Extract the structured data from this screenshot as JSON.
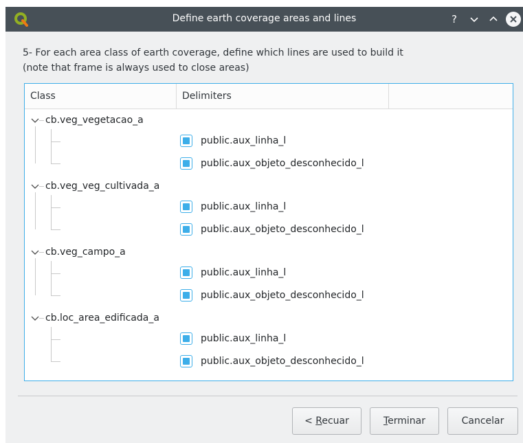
{
  "window": {
    "title": "Define earth coverage areas and lines",
    "help_glyph": "?",
    "minimize_glyph": "⌄",
    "maximize_glyph": "⌃"
  },
  "instructions": {
    "line1": "5- For each area class of earth coverage, define which lines are used to build it",
    "line2": "(note that frame is always used to close areas)"
  },
  "tree": {
    "headers": [
      "Class",
      "Delimiters",
      ""
    ],
    "groups": [
      {
        "label": "cb.veg_vegetacao_a",
        "expanded": true,
        "children": [
          {
            "label": "public.aux_linha_l",
            "checked": true
          },
          {
            "label": "public.aux_objeto_desconhecido_l",
            "checked": true
          }
        ]
      },
      {
        "label": "cb.veg_veg_cultivada_a",
        "expanded": true,
        "children": [
          {
            "label": "public.aux_linha_l",
            "checked": true
          },
          {
            "label": "public.aux_objeto_desconhecido_l",
            "checked": true
          }
        ]
      },
      {
        "label": "cb.veg_campo_a",
        "expanded": true,
        "children": [
          {
            "label": "public.aux_linha_l",
            "checked": true
          },
          {
            "label": "public.aux_objeto_desconhecido_l",
            "checked": true
          }
        ]
      },
      {
        "label": "cb.loc_area_edificada_a",
        "expanded": true,
        "children": [
          {
            "label": "public.aux_linha_l",
            "checked": true
          },
          {
            "label": "public.aux_objeto_desconhecido_l",
            "checked": true
          }
        ]
      }
    ]
  },
  "buttons": {
    "back": {
      "prefix": "< ",
      "mnemonic": "R",
      "rest": "ecuar"
    },
    "finish": {
      "prefix": "",
      "mnemonic": "T",
      "rest": "erminar"
    },
    "cancel": {
      "label": "Cancelar"
    }
  },
  "colors": {
    "accent": "#3daee9",
    "titlebar": "#475057",
    "window_bg": "#eff0f1"
  },
  "icons": {
    "app": "qgis-logo-icon",
    "expand": "chevron-down-icon",
    "checkbox": "checkbox-checked-icon",
    "close": "close-icon"
  }
}
